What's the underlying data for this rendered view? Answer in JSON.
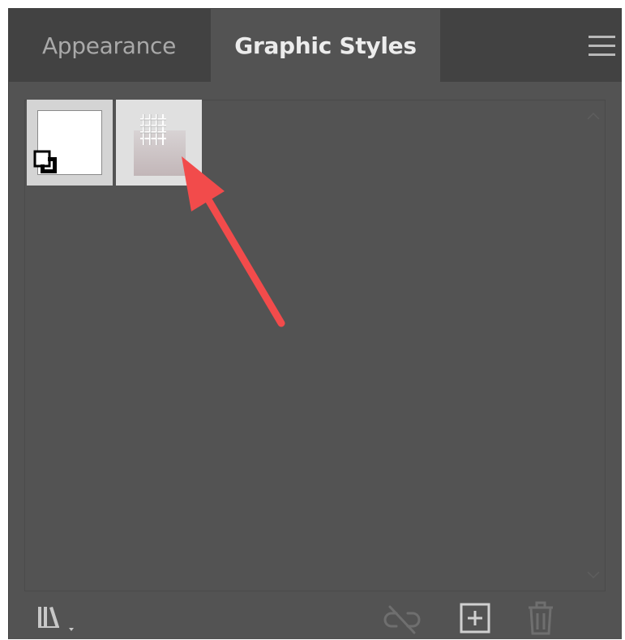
{
  "panel": {
    "tabs": [
      {
        "label": "Appearance",
        "active": false
      },
      {
        "label": "Graphic Styles",
        "active": true
      }
    ],
    "menu_icon": "hamburger-menu-icon"
  },
  "styles": [
    {
      "name": "default-graphic-style",
      "icon": "default-style-icon"
    },
    {
      "name": "grid-graphic-style",
      "icon": "grid-pattern-icon"
    }
  ],
  "annotation": {
    "icon": "red-arrow-icon",
    "color": "#f24b4b"
  },
  "footer": {
    "icons": [
      "graphic-styles-library-icon",
      "break-link-icon",
      "new-graphic-style-icon",
      "delete-style-icon"
    ]
  },
  "colors": {
    "panel_bg": "#535353",
    "tabbar_bg": "#424242",
    "active_tab_text": "#ececec",
    "inactive_tab_text": "#a9a9a9",
    "arrow": "#f24b4b"
  }
}
